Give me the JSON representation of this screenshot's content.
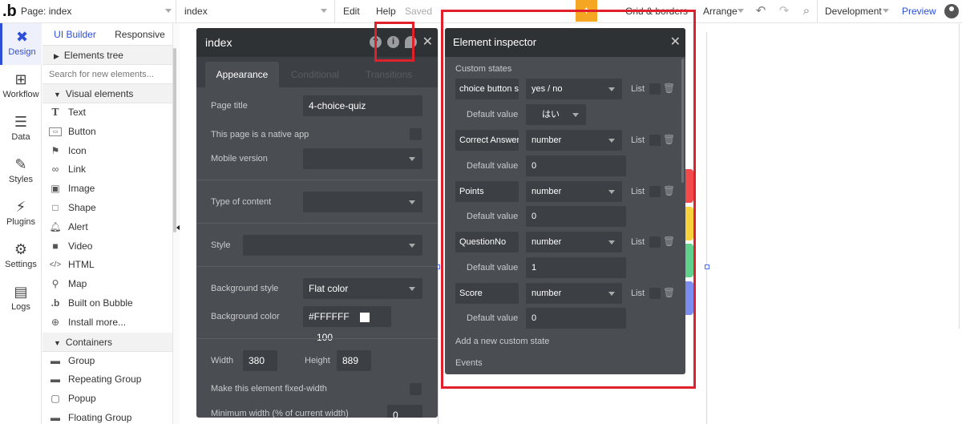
{
  "topbar": {
    "logo": ".b",
    "page_selector": "Page: index",
    "page_name": "index",
    "menu_edit": "Edit",
    "menu_help": "Help",
    "saved_status": "Saved",
    "grid_borders": "Grid & borders",
    "arrange": "Arrange",
    "environment": "Development",
    "preview": "Preview"
  },
  "leftnav": {
    "items": [
      {
        "label": "Design",
        "icon": "design-icon"
      },
      {
        "label": "Workflow",
        "icon": "workflow-icon"
      },
      {
        "label": "Data",
        "icon": "data-icon"
      },
      {
        "label": "Styles",
        "icon": "styles-icon"
      },
      {
        "label": "Plugins",
        "icon": "plugins-icon"
      },
      {
        "label": "Settings",
        "icon": "settings-icon"
      },
      {
        "label": "Logs",
        "icon": "logs-icon"
      }
    ]
  },
  "palette": {
    "tab_ui_builder": "UI Builder",
    "tab_responsive": "Responsive",
    "elements_tree": "Elements tree",
    "search_placeholder": "Search for new elements...",
    "visual_elements": "Visual elements",
    "items": [
      "Text",
      "Button",
      "Icon",
      "Link",
      "Image",
      "Shape",
      "Alert",
      "Video",
      "HTML",
      "Map",
      "Built on Bubble",
      "Install more..."
    ],
    "containers": "Containers",
    "container_items": [
      "Group",
      "Repeating Group",
      "Popup",
      "Floating Group"
    ]
  },
  "property_editor": {
    "title": "index",
    "tab_appearance": "Appearance",
    "tab_conditional": "Conditional",
    "tab_transitions": "Transitions",
    "page_title_label": "Page title",
    "page_title_value": "4-choice-quiz",
    "native_app_label": "This page is a native app",
    "mobile_version_label": "Mobile version",
    "type_of_content_label": "Type of content",
    "style_label": "Style",
    "bg_style_label": "Background style",
    "bg_style_value": "Flat color",
    "bg_color_label": "Background color",
    "bg_color_value": "#FFFFFF",
    "bg_opacity": "100",
    "width_label": "Width",
    "width_value": "380",
    "height_label": "Height",
    "height_value": "889",
    "fixed_width_label": "Make this element fixed-width",
    "min_width_label": "Minimum width (% of current width)",
    "min_width_value": "0"
  },
  "inspector": {
    "title": "Element inspector",
    "custom_states_label": "Custom states",
    "list_label": "List",
    "default_value_label": "Default value",
    "states": [
      {
        "name": "choice button s",
        "type": "yes / no",
        "default": "はい"
      },
      {
        "name": "Correct Answer",
        "type": "number",
        "default": "0"
      },
      {
        "name": "Points",
        "type": "number",
        "default": "0"
      },
      {
        "name": "QuestionNo",
        "type": "number",
        "default": "1"
      },
      {
        "name": "Score",
        "type": "number",
        "default": "0"
      }
    ],
    "add_state": "Add a new custom state",
    "events_label": "Events"
  },
  "colors": {
    "accent": "#2d4fd7",
    "panel_bg": "#4a4d51",
    "panel_header": "#2f3235",
    "highlight_red": "#e0202a",
    "gift_orange": "#f5a623",
    "bar_red": "#f24a4a",
    "bar_yellow": "#f7d23c",
    "bar_green": "#5fd18b",
    "bar_blue": "#7b8ef0"
  }
}
